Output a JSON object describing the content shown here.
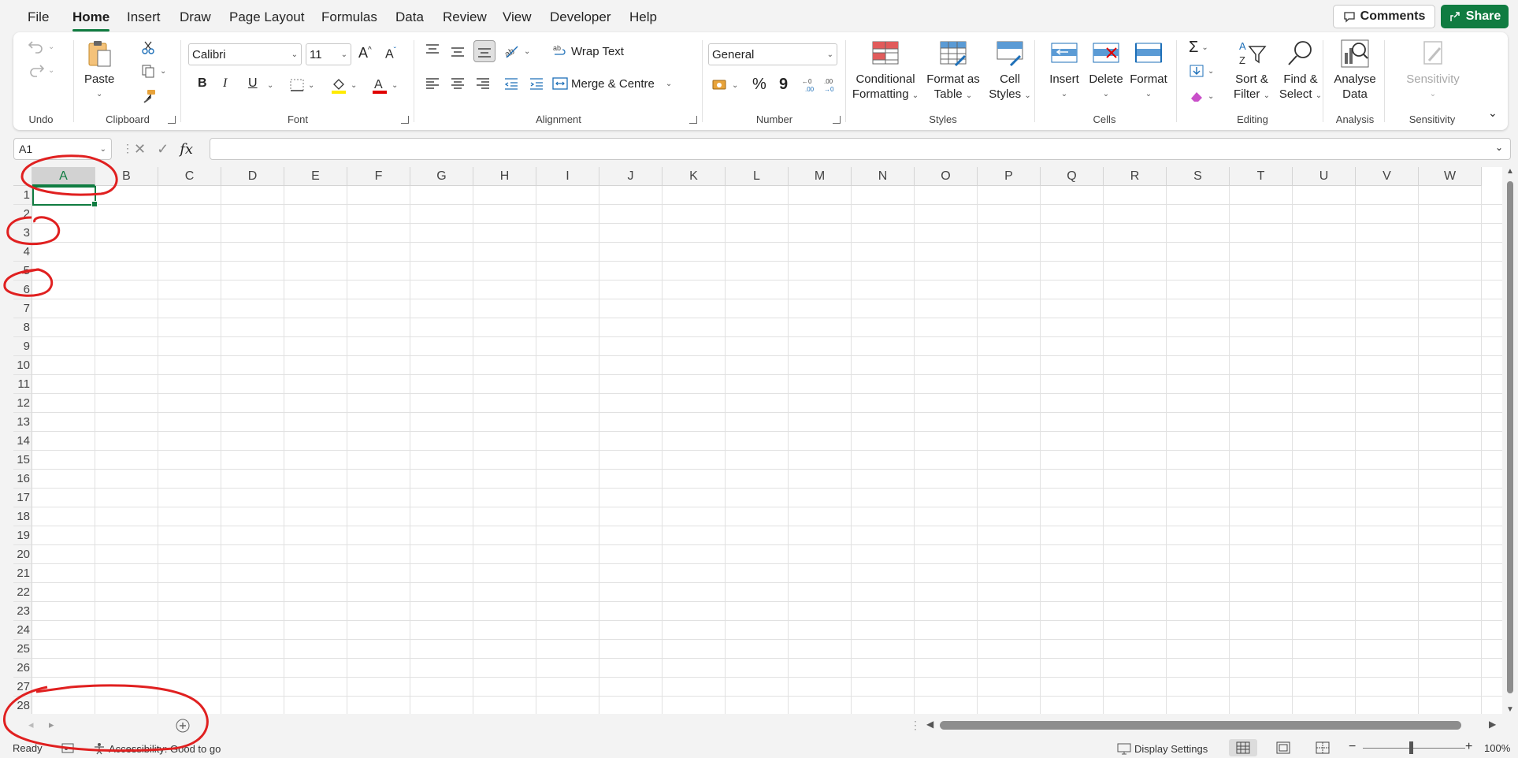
{
  "menu": {
    "tabs": [
      "File",
      "Home",
      "Insert",
      "Draw",
      "Page Layout",
      "Formulas",
      "Data",
      "Review",
      "View",
      "Developer",
      "Help"
    ],
    "active": "Home",
    "comments_label": "Comments",
    "share_label": "Share"
  },
  "ribbon": {
    "undo": {
      "label": "Undo"
    },
    "clipboard": {
      "label": "Clipboard",
      "paste": "Paste"
    },
    "font": {
      "label": "Font",
      "family": "Calibri",
      "size": "11",
      "bold": "B",
      "italic": "I",
      "underline": "U"
    },
    "alignment": {
      "label": "Alignment",
      "wrap_text": "Wrap Text",
      "merge_centre": "Merge & Centre"
    },
    "number": {
      "label": "Number",
      "format": "General",
      "percent": "%",
      "comma": "9"
    },
    "styles": {
      "label": "Styles",
      "conditional_1": "Conditional",
      "conditional_2": "Formatting",
      "format_table_1": "Format as",
      "format_table_2": "Table",
      "cell_styles_1": "Cell",
      "cell_styles_2": "Styles"
    },
    "cells": {
      "label": "Cells",
      "insert": "Insert",
      "delete": "Delete",
      "format": "Format"
    },
    "editing": {
      "label": "Editing",
      "sort_1": "Sort &",
      "sort_2": "Filter",
      "find_1": "Find &",
      "find_2": "Select"
    },
    "analysis": {
      "label": "Analysis",
      "analyse_1": "Analyse",
      "analyse_2": "Data"
    },
    "sensitivity": {
      "label": "Sensitivity",
      "button": "Sensitivity"
    }
  },
  "formula_bar": {
    "name_box": "A1",
    "formula": ""
  },
  "grid": {
    "columns": [
      "A",
      "B",
      "C",
      "D",
      "E",
      "F",
      "G",
      "H",
      "I",
      "J",
      "K",
      "L",
      "M",
      "N",
      "O",
      "P",
      "Q",
      "R",
      "S",
      "T",
      "U",
      "V",
      "W"
    ],
    "rows": [
      "1",
      "2",
      "3",
      "4",
      "5",
      "6",
      "7",
      "8",
      "9",
      "10",
      "11",
      "12",
      "13",
      "14",
      "15",
      "16",
      "17",
      "18",
      "19",
      "20",
      "21",
      "22",
      "23",
      "24",
      "25",
      "26",
      "27",
      "28"
    ],
    "selected_cell": "A1"
  },
  "status": {
    "ready": "Ready",
    "accessibility": "Accessibility: Good to go",
    "display_settings": "Display Settings",
    "zoom": "100%"
  },
  "colors": {
    "accent": "#107c41",
    "annotation": "#e02020"
  }
}
